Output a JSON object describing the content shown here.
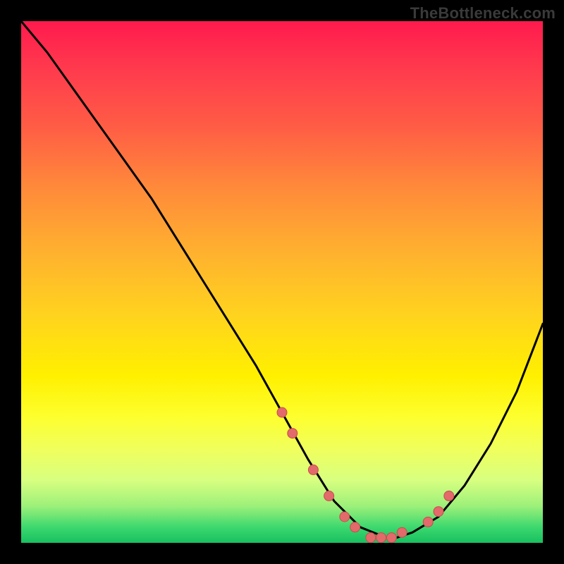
{
  "attribution": "TheBottleneck.com",
  "colors": {
    "page_bg": "#000000",
    "gradient_top": "#ff1a4d",
    "gradient_mid": "#fff000",
    "gradient_bottom": "#18c060",
    "curve": "#000000",
    "point_fill": "#e26a6a",
    "point_stroke": "#c94d4d"
  },
  "chart_data": {
    "type": "line",
    "title": "",
    "xlabel": "",
    "ylabel": "",
    "xlim": [
      0,
      100
    ],
    "ylim": [
      0,
      100
    ],
    "grid": false,
    "legend": false,
    "annotations": [],
    "series": [
      {
        "name": "bottleneck-curve",
        "x": [
          0,
          5,
          10,
          15,
          20,
          25,
          30,
          35,
          40,
          45,
          50,
          55,
          60,
          65,
          70,
          72,
          75,
          80,
          85,
          90,
          95,
          100
        ],
        "y": [
          100,
          94,
          87,
          80,
          73,
          66,
          58,
          50,
          42,
          34,
          25,
          16,
          8,
          3,
          1,
          1,
          2,
          5,
          11,
          19,
          29,
          42
        ]
      }
    ],
    "highlight_points": {
      "name": "curve-markers",
      "x": [
        50,
        52,
        56,
        59,
        62,
        64,
        67,
        69,
        71,
        73,
        78,
        80,
        82
      ],
      "y": [
        25,
        21,
        14,
        9,
        5,
        3,
        1,
        1,
        1,
        2,
        4,
        6,
        9
      ]
    }
  }
}
